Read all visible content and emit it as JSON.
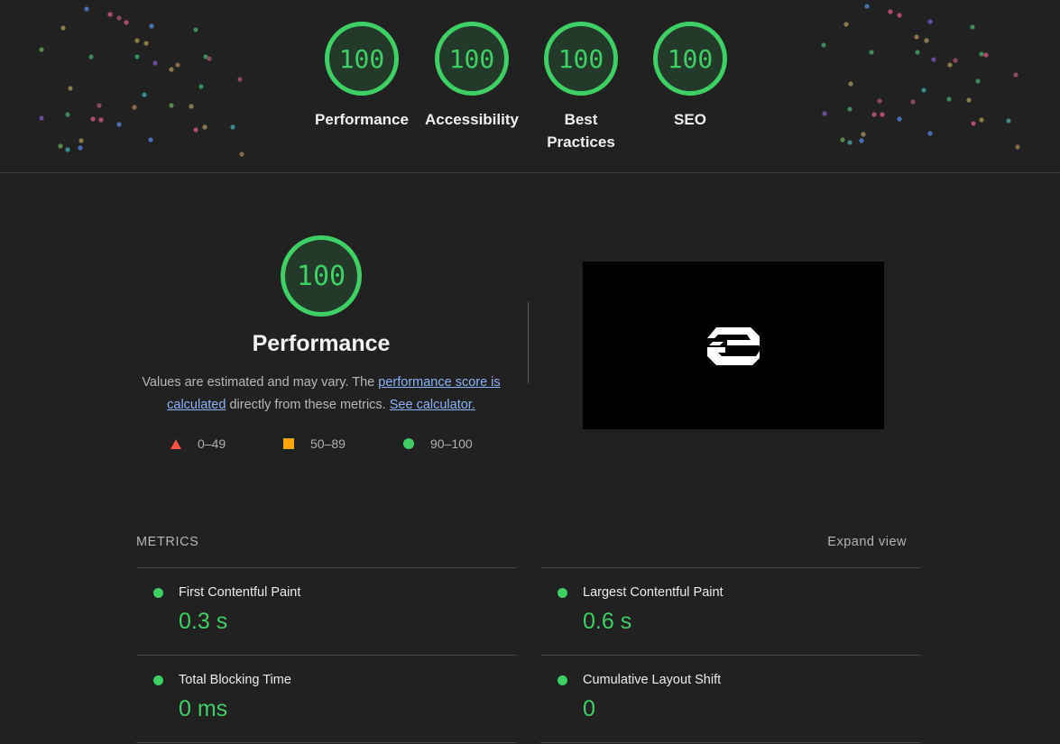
{
  "colors": {
    "background": "#212121",
    "pass_green": "#3ecf65",
    "average_orange": "#ffa400",
    "fail_red": "#ff4e42",
    "link_blue": "#8ab4f8"
  },
  "summary_gauges": [
    {
      "score": "100",
      "label": "Performance"
    },
    {
      "score": "100",
      "label": "Accessibility"
    },
    {
      "score": "100",
      "label": "Best Practices"
    },
    {
      "score": "100",
      "label": "SEO"
    }
  ],
  "performance": {
    "score": "100",
    "title": "Performance",
    "desc_prefix": "Values are estimated and may vary. The",
    "link_score": "performance score is calculated",
    "desc_middle": "directly from these metrics.",
    "link_calculator": "See calculator.",
    "legend": [
      {
        "shape": "triangle",
        "range": "0–49"
      },
      {
        "shape": "square",
        "range": "50–89"
      },
      {
        "shape": "circle",
        "range": "90–100"
      }
    ]
  },
  "metrics": {
    "heading": "METRICS",
    "expand_label": "Expand view",
    "items": [
      {
        "name": "First Contentful Paint",
        "value": "0.3 s"
      },
      {
        "name": "Largest Contentful Paint",
        "value": "0.6 s"
      },
      {
        "name": "Total Blocking Time",
        "value": "0 ms"
      },
      {
        "name": "Cumulative Layout Shift",
        "value": "0"
      }
    ]
  }
}
